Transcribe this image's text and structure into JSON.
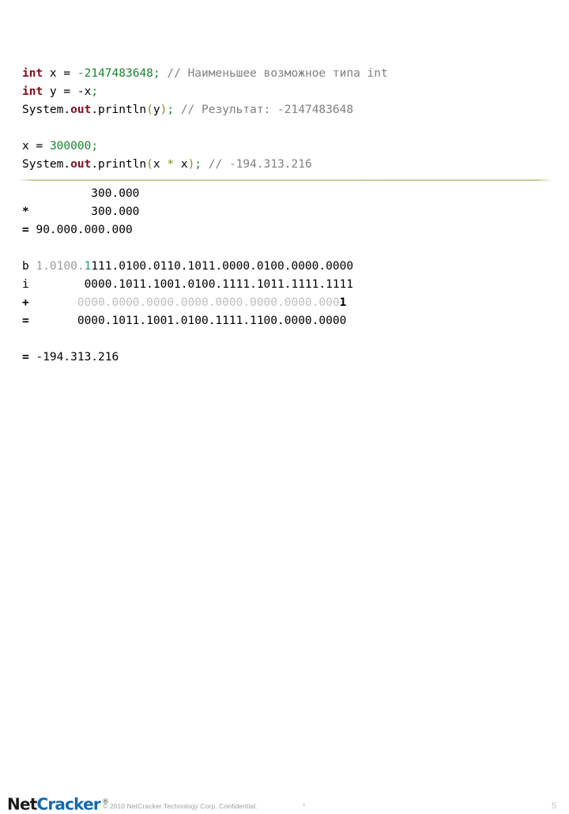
{
  "slide": {
    "page_number": "5",
    "code": {
      "lines": [
        {
          "id": "line1",
          "segments": [
            {
              "text": "int",
              "style": "kw"
            },
            {
              "text": " x ",
              "style": "plain"
            },
            {
              "text": "= ",
              "style": "plain"
            },
            {
              "text": "-2147483648",
              "style": "num"
            },
            {
              "text": ";",
              "style": "punct"
            },
            {
              "text": " ",
              "style": "plain"
            },
            {
              "text": "// Наименьшее возможное типа int",
              "style": "comment"
            }
          ]
        },
        {
          "id": "line2",
          "segments": [
            {
              "text": "int",
              "style": "kw"
            },
            {
              "text": " y ",
              "style": "plain"
            },
            {
              "text": "= -x",
              "style": "plain"
            },
            {
              "text": ";",
              "style": "punct"
            }
          ]
        },
        {
          "id": "line3",
          "segments": [
            {
              "text": "System.",
              "style": "plain"
            },
            {
              "text": "out",
              "style": "kw"
            },
            {
              "text": ".println",
              "style": "plain"
            },
            {
              "text": "(",
              "style": "paren"
            },
            {
              "text": "y",
              "style": "plain"
            },
            {
              "text": ")",
              "style": "paren"
            },
            {
              "text": ";",
              "style": "punct"
            },
            {
              "text": " ",
              "style": "plain"
            },
            {
              "text": "// Результат: -2147483648",
              "style": "comment"
            }
          ]
        },
        {
          "id": "blank1",
          "segments": []
        },
        {
          "id": "line4",
          "segments": [
            {
              "text": "x ",
              "style": "plain"
            },
            {
              "text": "= ",
              "style": "plain"
            },
            {
              "text": "300000",
              "style": "num"
            },
            {
              "text": ";",
              "style": "punct"
            }
          ]
        },
        {
          "id": "line5",
          "segments": [
            {
              "text": "System.",
              "style": "plain"
            },
            {
              "text": "out",
              "style": "kw"
            },
            {
              "text": ".println",
              "style": "plain"
            },
            {
              "text": "(",
              "style": "paren"
            },
            {
              "text": "x ",
              "style": "plain"
            },
            {
              "text": "*",
              "style": "paren"
            },
            {
              "text": " x",
              "style": "plain"
            },
            {
              "text": ")",
              "style": "paren"
            },
            {
              "text": ";",
              "style": "punct"
            },
            {
              "text": " ",
              "style": "plain"
            },
            {
              "text": "// -194.313.216",
              "style": "comment"
            }
          ]
        }
      ]
    },
    "calc": {
      "lines": [
        {
          "id": "calc-operand-1",
          "segments": [
            {
              "text": "          300.000",
              "style": "plain"
            }
          ]
        },
        {
          "id": "calc-operand-2",
          "segments": [
            {
              "text": "*",
              "style": "op"
            },
            {
              "text": "         300.000",
              "style": "plain"
            }
          ]
        },
        {
          "id": "calc-product",
          "segments": [
            {
              "text": "=",
              "style": "op"
            },
            {
              "text": " 90.000.000.000",
              "style": "plain"
            }
          ]
        },
        {
          "id": "calc-blank-1",
          "segments": []
        },
        {
          "id": "binary-b",
          "segments": [
            {
              "text": "b",
              "style": "plain"
            },
            {
              "text": " 1.0100.",
              "style": "mid"
            },
            {
              "text": "1",
              "style": "hl"
            },
            {
              "text": "111.0100.0110.1011.0000.0100.0000.0000",
              "style": "plain"
            }
          ]
        },
        {
          "id": "binary-i",
          "segments": [
            {
              "text": "i",
              "style": "plain"
            },
            {
              "text": "        0000.1011.1001.0100.1111.1011.1111.1111",
              "style": "plain"
            }
          ]
        },
        {
          "id": "binary-plus",
          "segments": [
            {
              "text": "+",
              "style": "op"
            },
            {
              "text": "       0000.0000.0000.0000.0000.0000.0000.000",
              "style": "dim"
            },
            {
              "text": "1",
              "style": "bold-digit"
            }
          ]
        },
        {
          "id": "binary-sum",
          "segments": [
            {
              "text": "=",
              "style": "op"
            },
            {
              "text": "       0000.1011.1001.0100.1111.1100.0000.0000",
              "style": "plain"
            }
          ]
        },
        {
          "id": "calc-blank-2",
          "segments": []
        },
        {
          "id": "calc-result",
          "segments": [
            {
              "text": "=",
              "style": "op"
            },
            {
              "text": " -194.313.216",
              "style": "plain"
            }
          ]
        }
      ]
    }
  },
  "footer": {
    "logo_net": "Net",
    "logo_cracker": "Cracker",
    "logo_registered": "®",
    "copyright": "© 2010 NetCracker Technology Corp. Confidential.",
    "asterisk": "*"
  },
  "colors": {
    "keyword": "#7f0f1f",
    "number": "#18852f",
    "comment": "#808080",
    "paren": "#8a8a20",
    "highlight": "#1a9d6e",
    "divider": "#c9cb9b",
    "logo_blue": "#1568b0"
  }
}
